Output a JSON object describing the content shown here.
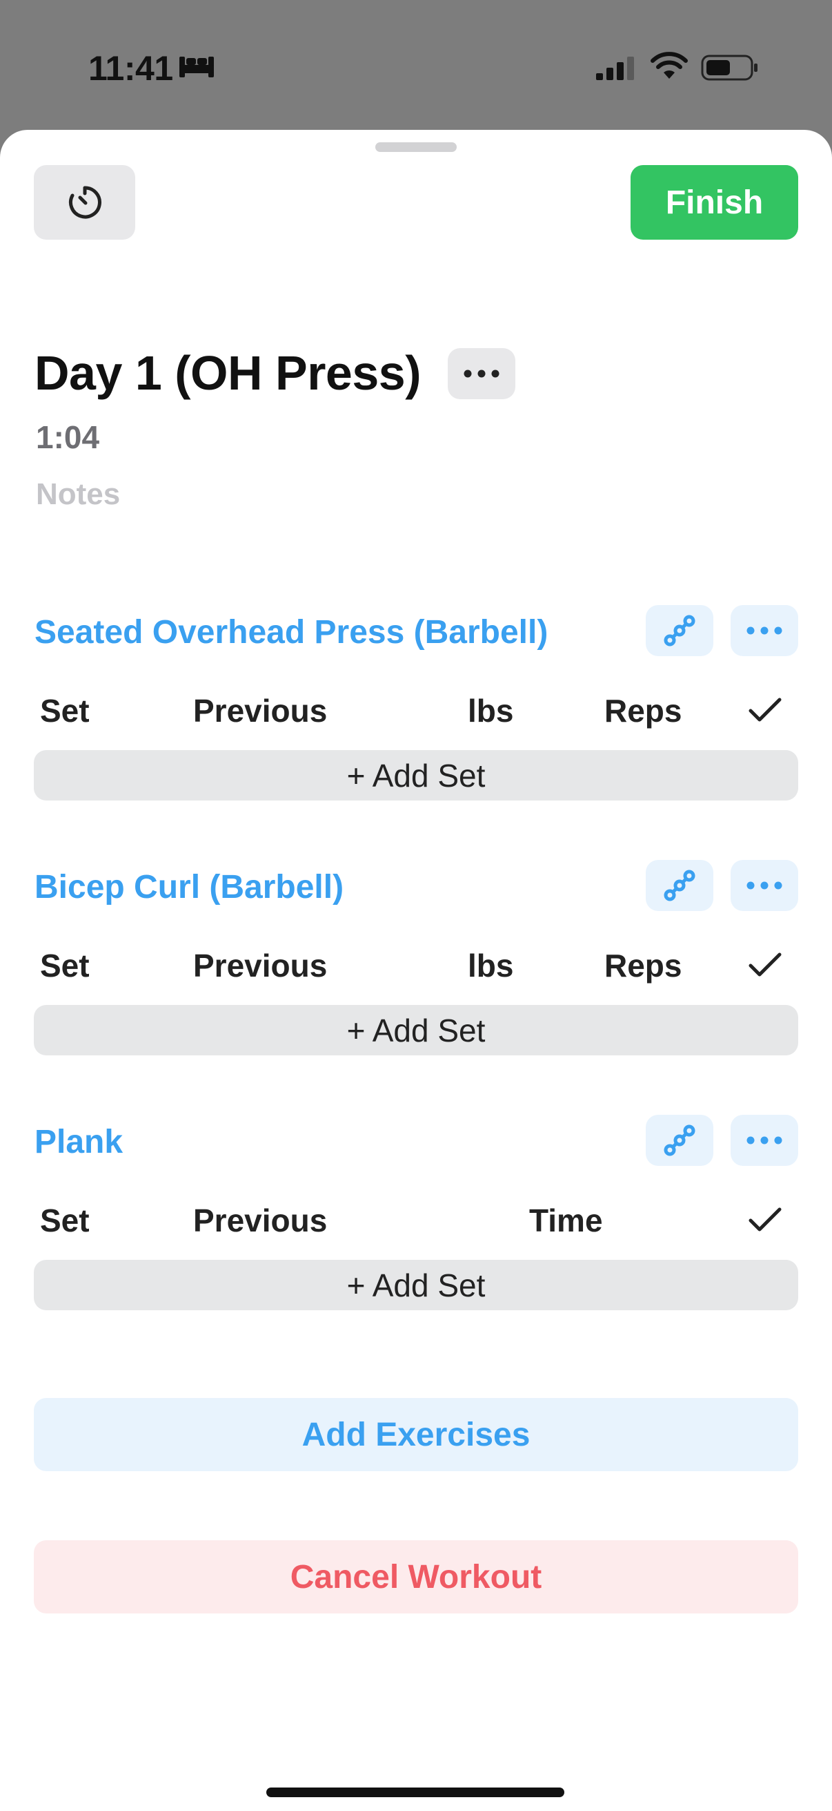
{
  "status_bar": {
    "time": "11:41",
    "icons": [
      "bed-icon",
      "cellular-signal-icon",
      "wifi-icon",
      "battery-icon"
    ]
  },
  "toolbar": {
    "timer_icon": "timer-icon",
    "finish_label": "Finish"
  },
  "workout": {
    "title": "Day 1 (OH Press)",
    "elapsed": "1:04",
    "notes_placeholder": "Notes"
  },
  "exercises": [
    {
      "name": "Seated Overhead Press (Barbell)",
      "columns": [
        "Set",
        "Previous",
        "lbs",
        "Reps"
      ],
      "add_set_label": "+ Add Set"
    },
    {
      "name": "Bicep Curl (Barbell)",
      "columns": [
        "Set",
        "Previous",
        "lbs",
        "Reps"
      ],
      "add_set_label": "+ Add Set"
    },
    {
      "name": "Plank",
      "columns": [
        "Set",
        "Previous",
        "Time"
      ],
      "add_set_label": "+ Add Set"
    }
  ],
  "actions": {
    "add_exercises_label": "Add Exercises",
    "cancel_workout_label": "Cancel Workout"
  },
  "colors": {
    "accent_blue": "#3aa0f0",
    "finish_green": "#33c462",
    "cancel_red": "#ef5a63"
  }
}
